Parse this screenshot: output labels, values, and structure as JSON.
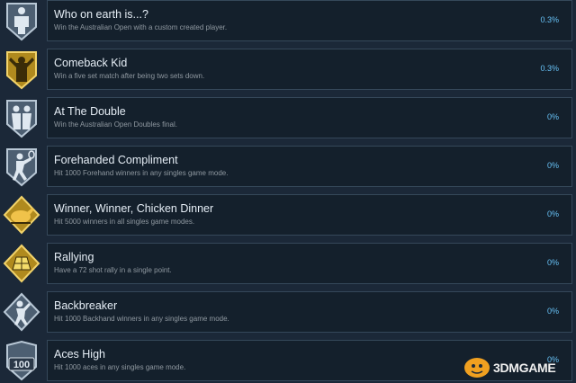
{
  "achievements": [
    {
      "title": "Who on earth is...?",
      "description": "Win the Australian Open with a custom created player.",
      "percent": "0.3%",
      "icon": "custom-player-icon",
      "theme": "silver"
    },
    {
      "title": "Comeback Kid",
      "description": "Win a five set match after being two sets down.",
      "percent": "0.3%",
      "icon": "comeback-player-icon",
      "theme": "gold"
    },
    {
      "title": "At The Double",
      "description": "Win the Australian Open Doubles final.",
      "percent": "0%",
      "icon": "doubles-players-icon",
      "theme": "silver"
    },
    {
      "title": "Forehanded Compliment",
      "description": "Hit 1000 Forehand winners in any singles game mode.",
      "percent": "0%",
      "icon": "forehand-player-icon",
      "theme": "silver"
    },
    {
      "title": "Winner, Winner, Chicken Dinner",
      "description": "Hit 5000 winners in all singles game modes.",
      "percent": "0%",
      "icon": "roast-chicken-icon",
      "theme": "gold"
    },
    {
      "title": "Rallying",
      "description": "Have a 72 shot rally in a single point.",
      "percent": "0%",
      "icon": "tennis-court-icon",
      "theme": "gold"
    },
    {
      "title": "Backbreaker",
      "description": "Hit 1000 Backhand winners in any singles game mode.",
      "percent": "0%",
      "icon": "backhand-player-icon",
      "theme": "silver"
    },
    {
      "title": "Aces High",
      "description": "Hit 1000 aces in any singles game mode.",
      "percent": "0%",
      "icon": "hundred-badge-icon",
      "theme": "silver",
      "badge_text": "100"
    }
  ],
  "watermark": {
    "text": "3DMGAME"
  },
  "colors": {
    "background": "#1b2838",
    "row": "#14202c",
    "border": "#35485a",
    "percent": "#67c1f5",
    "gold": "#d9b43a",
    "silver": "#9fb3c8"
  }
}
